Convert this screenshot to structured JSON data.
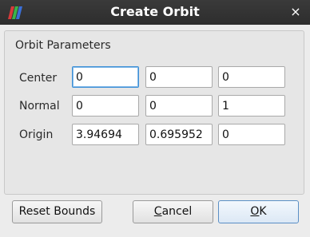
{
  "window": {
    "title": "Create Orbit",
    "close_symbol": "×"
  },
  "icons": {
    "app": "paraview-logo-icon",
    "close": "close-icon"
  },
  "group": {
    "title": "Orbit Parameters",
    "rows": [
      {
        "label": "Center",
        "values": [
          "0",
          "0",
          "0"
        ]
      },
      {
        "label": "Normal",
        "values": [
          "0",
          "0",
          "1"
        ]
      },
      {
        "label": "Origin",
        "values": [
          "3.94694",
          "0.695952",
          "0"
        ]
      }
    ]
  },
  "buttons": {
    "reset_bounds": "Reset Bounds",
    "cancel_mnemonic": "C",
    "cancel_rest": "ancel",
    "ok_mnemonic": "O",
    "ok_rest": "K"
  },
  "colors": {
    "titlebar": "#2d2d2d",
    "focus_border": "#3d8fd6",
    "default_button_border": "#5b8fc5"
  }
}
